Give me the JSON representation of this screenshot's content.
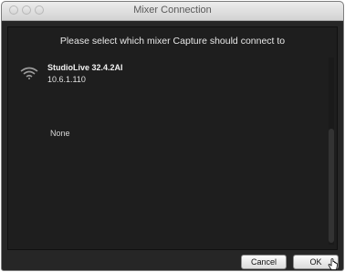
{
  "window": {
    "title": "Mixer Connection"
  },
  "dialog": {
    "prompt": "Please select which mixer Capture should connect to",
    "devices": [
      {
        "name": "StudioLive 32.4.2AI",
        "ip": "10.6.1.110",
        "icon": "wifi-icon"
      }
    ],
    "none_label": "None"
  },
  "buttons": {
    "cancel_label": "Cancel",
    "ok_label": "OK"
  },
  "colors": {
    "window_bg": "#262626",
    "list_bg": "#1e1e1e",
    "titlebar": "#dcdcdc"
  }
}
